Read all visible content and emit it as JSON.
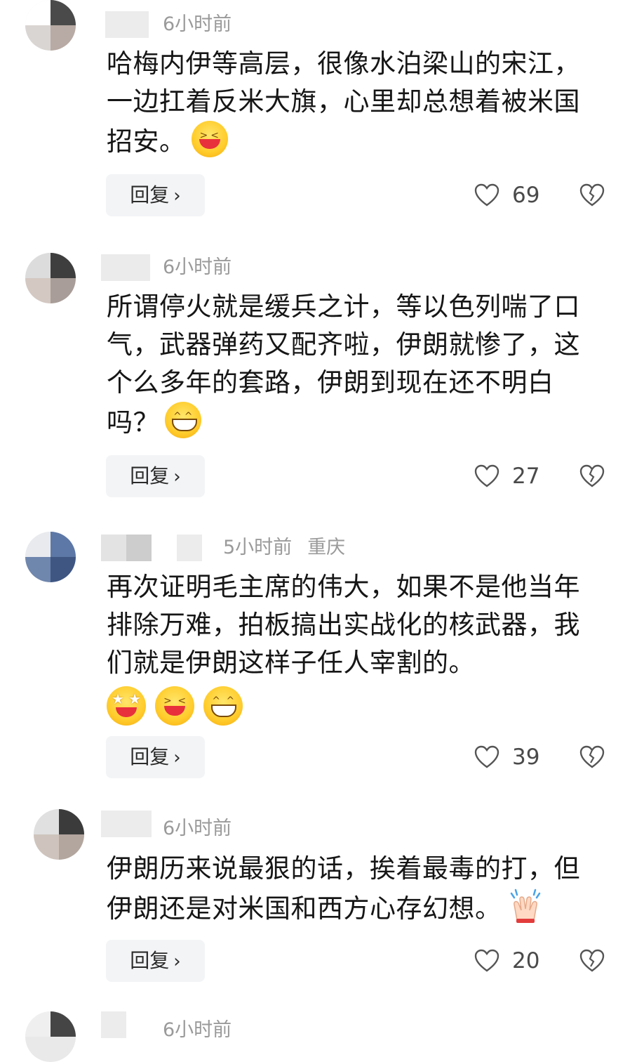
{
  "comments": [
    {
      "time": "6小时前",
      "location": "",
      "text": "哈梅内伊等高层，很像水泊梁山的宋江，一边扛着反米大旗，心里却总想着被米国招安。",
      "emojis": [
        "grin-squint-emoji"
      ],
      "reply_label": "回复",
      "likes": "69"
    },
    {
      "time": "6小时前",
      "location": "",
      "text": "所谓停火就是缓兵之计，等以色列喘了口气，武器弹药又配齐啦，伊朗就惨了，这个么多年的套路，伊朗到现在还不明白吗？",
      "emojis": [
        "grin-teeth-emoji"
      ],
      "reply_label": "回复",
      "likes": "27"
    },
    {
      "time": "5小时前",
      "location": "重庆",
      "text": "再次证明毛主席的伟大，如果不是他当年排除万难，拍板搞出实战化的核武器，我们就是伊朗这样子任人宰割的。",
      "emojis": [
        "star-eyes-emoji",
        "grin-squint-emoji",
        "grin-teeth-emoji"
      ],
      "reply_label": "回复",
      "likes": "39"
    },
    {
      "time": "6小时前",
      "location": "",
      "text": "伊朗历来说最狠的话，挨着最毒的打，但伊朗还是对米国和西方心存幻想。",
      "emojis": [
        "clapping-hands-emoji"
      ],
      "reply_label": "回复",
      "likes": "20"
    },
    {
      "time": "6小时前",
      "location": ""
    }
  ],
  "colors": {
    "meta_text": "#9a9a9a",
    "body_text": "#161616",
    "reply_bg": "#f3f4f6",
    "emoji_yellow": "#ffcc2b"
  }
}
